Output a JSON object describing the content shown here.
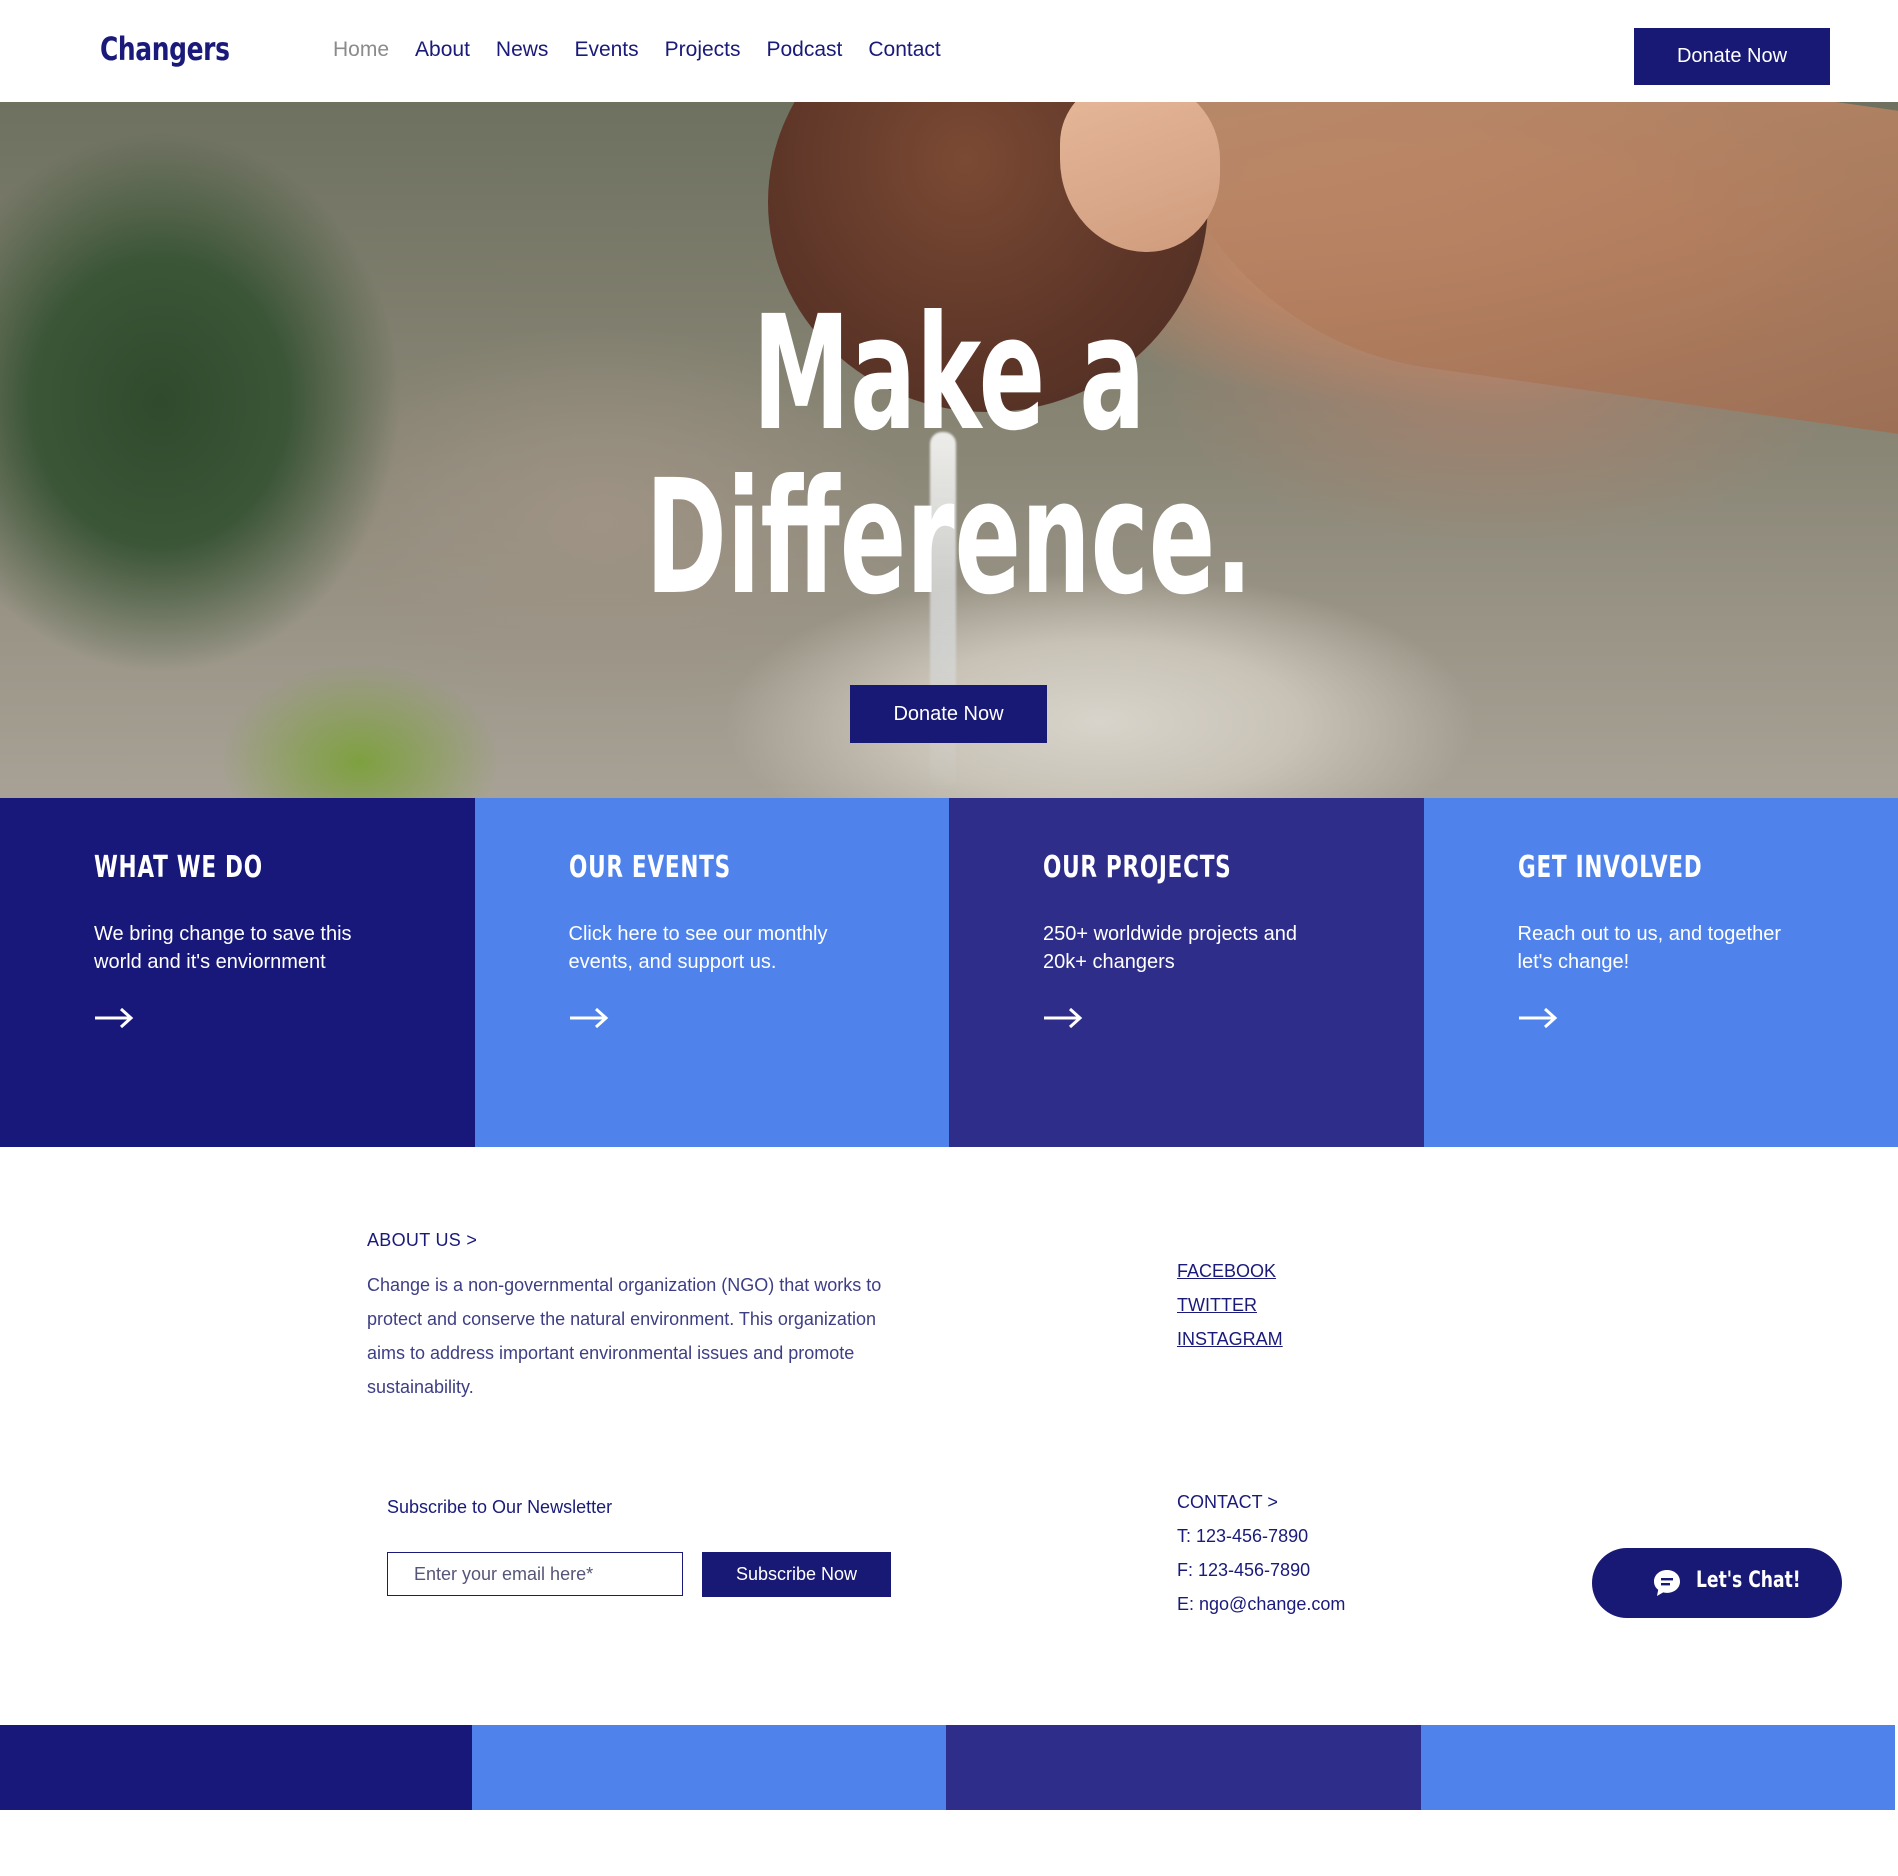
{
  "brand": {
    "name": "Changers"
  },
  "nav": {
    "items": [
      {
        "label": "Home",
        "active": true
      },
      {
        "label": "About",
        "active": false
      },
      {
        "label": "News",
        "active": false
      },
      {
        "label": "Events",
        "active": false
      },
      {
        "label": "Projects",
        "active": false
      },
      {
        "label": "Podcast",
        "active": false
      },
      {
        "label": "Contact",
        "active": false
      }
    ],
    "donate_label": "Donate Now"
  },
  "hero": {
    "line1": "Make a",
    "line2": "Difference.",
    "donate_label": "Donate Now"
  },
  "tiles": [
    {
      "title": "WHAT WE DO",
      "text": "We bring change to save this world and it's enviornment",
      "color": "#18187a",
      "icon": "arrow-right-icon"
    },
    {
      "title": "OUR EVENTS",
      "text": "Click here to see our monthly events, and support us.",
      "color": "#4f83eb",
      "icon": "arrow-right-icon"
    },
    {
      "title": "OUR PROJECTS",
      "text": "250+ worldwide projects and 20k+ changers",
      "color": "#2e2d8a",
      "icon": "arrow-right-icon"
    },
    {
      "title": "GET INVOLVED",
      "text": "Reach out to us, and together let's change!",
      "color": "#4f83eb",
      "icon": "arrow-right-icon"
    }
  ],
  "about": {
    "title": "ABOUT US >",
    "text": "Change is a non-governmental organization (NGO) that works to protect and conserve the natural environment. This organization aims to address important environmental issues and promote sustainability."
  },
  "social": {
    "links": [
      "FACEBOOK",
      "TWITTER",
      "INSTAGRAM"
    ]
  },
  "newsletter": {
    "title": "Subscribe to Our Newsletter",
    "placeholder": "Enter your email here*",
    "button_label": "Subscribe Now"
  },
  "contact": {
    "title": "CONTACT >",
    "phone": "T: 123-456-7890",
    "fax": "F: 123-456-7890",
    "email": "E: ngo@change.com"
  },
  "chat": {
    "label": "Let's Chat!",
    "icon": "chat-bubble-icon"
  },
  "colors": {
    "navy": "#18187a",
    "blue": "#4f83eb",
    "indigo": "#2e2d8a",
    "button": "#181875"
  }
}
